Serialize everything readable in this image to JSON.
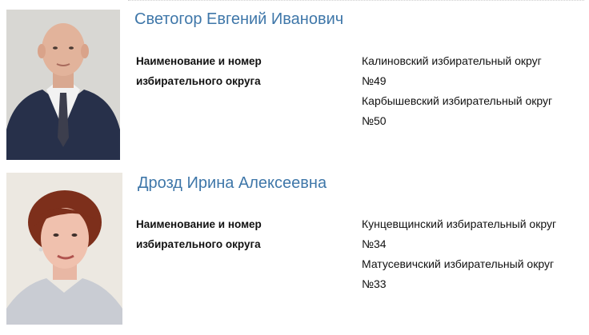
{
  "persons": [
    {
      "name": "Светогор Евгений Иванович",
      "field_label_line1": "Наименование и номер",
      "field_label_line2": "избирательного округа",
      "districts": [
        {
          "name": "Калиновский избирательный округ",
          "number": "№49"
        },
        {
          "name": "Карбышевский избирательный округ",
          "number": "№50"
        }
      ]
    },
    {
      "name": "Дрозд Ирина Алексеевна",
      "field_label_line1": "Наименование и номер",
      "field_label_line2": "избирательного округа",
      "districts": [
        {
          "name": "Кунцевщинский избирательный округ",
          "number": "№34"
        },
        {
          "name": "Матусевичский избирательный округ",
          "number": "№33"
        }
      ]
    }
  ],
  "colors": {
    "name_link": "#3f77a9",
    "suit": "#2a3347",
    "background_photo1": "#d9d8d4",
    "background_photo2": "#ece9e3"
  }
}
